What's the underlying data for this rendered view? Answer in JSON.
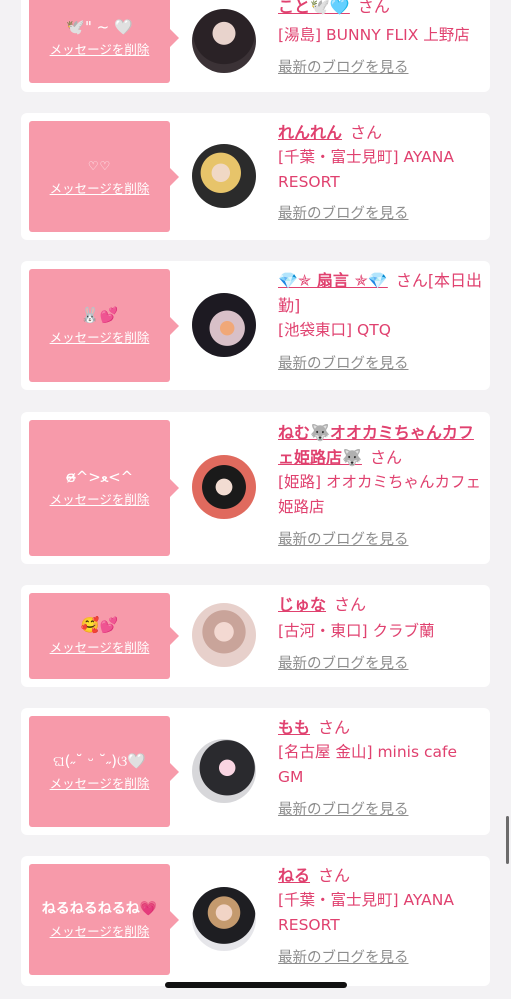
{
  "cards": [
    {
      "message": "🕊️\" ~ 🤍",
      "delete_label": "メッセージを削除",
      "name": "こと🕊️🩵",
      "suffix": "さん",
      "shop": "[湯島] BUNNY FLIX 上野店",
      "blog_link": "最新のブログを見る"
    },
    {
      "message": "♡♡",
      "delete_label": "メッセージを削除",
      "name": "れんれん",
      "suffix": "さん",
      "shop": "[千葉・富士見町] AYANA RESORT",
      "blog_link": "最新のブログを見る"
    },
    {
      "message": "🐰💕",
      "delete_label": "メッセージを削除",
      "name": "💎✯ 扇言 ✯💎",
      "suffix": "さん[本日出勤]",
      "shop": "[池袋東口] QTQ",
      "blog_link": "最新のブログを見る"
    },
    {
      "message": "ɞ̴̶̷^>ﻌ<^",
      "delete_label": "メッセージを削除",
      "name": "ねむ🐺オオカミちゃんカフェ姫路店🐺",
      "suffix": "さん",
      "shop": "[姫路] オオカミちゃんカフェ姫路店",
      "blog_link": "最新のブログを見る"
    },
    {
      "message": "🥰💕",
      "delete_label": "メッセージを削除",
      "name": "じゅな",
      "suffix": "さん",
      "shop": "[古河・東口] クラブ蘭",
      "blog_link": "最新のブログを見る"
    },
    {
      "message": "ଘ(˶˘ ᵕ ˘˶)ଓ🤍",
      "delete_label": "メッセージを削除",
      "name": "もも",
      "suffix": "さん",
      "shop": "[名古屋 金山] minis cafe GM",
      "blog_link": "最新のブログを見る"
    },
    {
      "message": "ねるねるねるね💗",
      "delete_label": "メッセージを削除",
      "name": "ねる",
      "suffix": "さん",
      "shop": "[千葉・富士見町] AYANA RESORT",
      "blog_link": "最新のブログを見る"
    }
  ]
}
